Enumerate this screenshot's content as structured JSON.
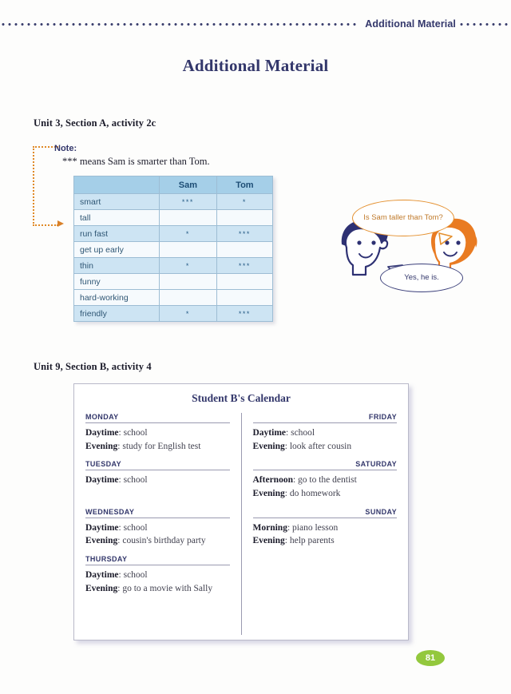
{
  "header": {
    "title": "Additional Material",
    "left_dots_icon": "dotted-rule-icon",
    "right_dots_icon": "dotted-rule-icon"
  },
  "page_title": "Additional Material",
  "page_number": "81",
  "section_unit3": {
    "heading": "Unit 3, Section A, activity 2c",
    "note_label": "Note:",
    "note_text": "*** means Sam is smarter than Tom.",
    "table": {
      "columns": [
        "",
        "Sam",
        "Tom"
      ],
      "rows": [
        {
          "label": "smart",
          "sam": "***",
          "tom": "*"
        },
        {
          "label": "tall",
          "sam": "",
          "tom": ""
        },
        {
          "label": "run fast",
          "sam": "*",
          "tom": "***"
        },
        {
          "label": "get up early",
          "sam": "",
          "tom": ""
        },
        {
          "label": "thin",
          "sam": "*",
          "tom": "***"
        },
        {
          "label": "funny",
          "sam": "",
          "tom": ""
        },
        {
          "label": "hard-working",
          "sam": "",
          "tom": ""
        },
        {
          "label": "friendly",
          "sam": "*",
          "tom": "***"
        }
      ]
    },
    "cartoon": {
      "question_bubble": "Is Sam taller than Tom?",
      "answer_bubble": "Yes, he is.",
      "left_character_icon": "boy-blue-hair-icon",
      "right_character_icon": "girl-orange-hair-icon"
    }
  },
  "section_unit9": {
    "heading": "Unit 9, Section B, activity 4",
    "calendar": {
      "title": "Student B's Calendar",
      "left_column": [
        {
          "day": "MONDAY",
          "entries": [
            {
              "label": "Daytime",
              "value": "school"
            },
            {
              "label": "Evening",
              "value": "study for English test"
            }
          ]
        },
        {
          "day": "TUESDAY",
          "entries": [
            {
              "label": "Daytime",
              "value": "school"
            }
          ]
        },
        {
          "day": "WEDNESDAY",
          "entries": [
            {
              "label": "Daytime",
              "value": "school"
            },
            {
              "label": "Evening",
              "value": "cousin's birthday party"
            }
          ]
        },
        {
          "day": "THURSDAY",
          "entries": [
            {
              "label": "Daytime",
              "value": "school"
            },
            {
              "label": "Evening",
              "value": "go to a movie with Sally"
            }
          ]
        }
      ],
      "right_column": [
        {
          "day": "FRIDAY",
          "entries": [
            {
              "label": "Daytime",
              "value": "school"
            },
            {
              "label": "Evening",
              "value": "look after cousin"
            }
          ]
        },
        {
          "day": "SATURDAY",
          "entries": [
            {
              "label": "Afternoon",
              "value": "go to the dentist"
            },
            {
              "label": "Evening",
              "value": "do homework"
            }
          ]
        },
        {
          "day": "SUNDAY",
          "entries": [
            {
              "label": "Morning",
              "value": "piano lesson"
            },
            {
              "label": "Evening",
              "value": "help parents"
            }
          ]
        }
      ]
    }
  },
  "colors": {
    "navy": "#33376b",
    "table_header_blue": "#a5cfe8",
    "table_row_blue": "#cde4f3",
    "accent_orange": "#e4902f",
    "page_badge_green": "#93c83d"
  }
}
